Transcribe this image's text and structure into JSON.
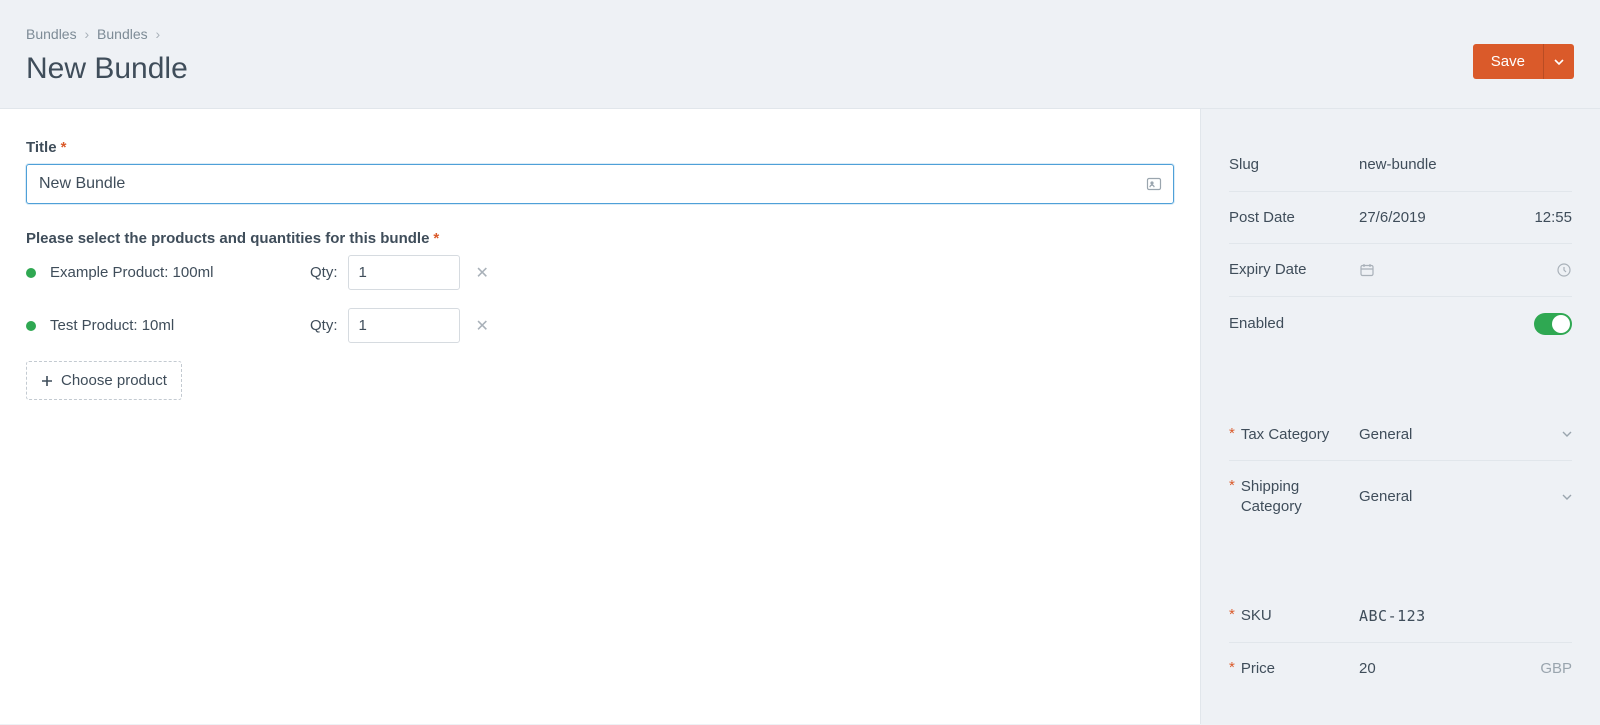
{
  "breadcrumb": {
    "item1": "Bundles",
    "item2": "Bundles"
  },
  "page_title": "New Bundle",
  "save_label": "Save",
  "fields": {
    "title_label": "Title",
    "title_value": "New Bundle",
    "products_label": "Please select the products and quantities for this bundle",
    "qty_label": "Qty:",
    "choose_label": "Choose product"
  },
  "products": [
    {
      "name": "Example Product: 100ml",
      "qty": "1"
    },
    {
      "name": "Test Product: 10ml",
      "qty": "1"
    }
  ],
  "sidebar": {
    "slug_label": "Slug",
    "slug_value": "new-bundle",
    "postdate_label": "Post Date",
    "postdate_date": "27/6/2019",
    "postdate_time": "12:55",
    "expiry_label": "Expiry Date",
    "enabled_label": "Enabled",
    "tax_label": "Tax Category",
    "tax_value": "General",
    "ship_label": "Shipping Category",
    "ship_value": "General",
    "sku_label": "SKU",
    "sku_value": "ABC-123",
    "price_label": "Price",
    "price_value": "20",
    "price_currency": "GBP"
  }
}
